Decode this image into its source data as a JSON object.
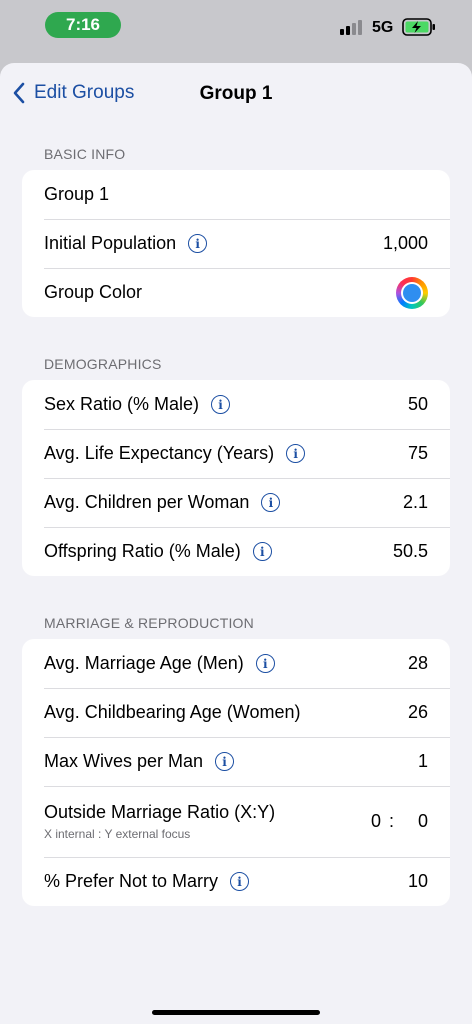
{
  "status": {
    "time": "7:16",
    "network": "5G"
  },
  "nav": {
    "back_label": "Edit Groups",
    "title": "Group 1"
  },
  "basic": {
    "header": "BASIC INFO",
    "name": "Group 1",
    "initial_population_label": "Initial Population",
    "initial_population": "1,000",
    "group_color_label": "Group Color",
    "group_color": "#2f8ef0"
  },
  "demographics": {
    "header": "DEMOGRAPHICS",
    "rows": [
      {
        "label": "Sex Ratio (% Male)",
        "value": "50"
      },
      {
        "label": "Avg. Life Expectancy (Years)",
        "value": "75"
      },
      {
        "label": "Avg. Children per Woman",
        "value": "2.1"
      },
      {
        "label": "Offspring Ratio (% Male)",
        "value": "50.5"
      }
    ]
  },
  "marriage": {
    "header": "MARRIAGE & REPRODUCTION",
    "marriage_age_men_label": "Avg. Marriage Age (Men)",
    "marriage_age_men": "28",
    "childbearing_age_label": "Avg. Childbearing Age (Women)",
    "childbearing_age": "26",
    "max_wives_label": "Max Wives per Man",
    "max_wives": "1",
    "outside_ratio_label": "Outside Marriage Ratio (X:Y)",
    "outside_ratio_sub": "X internal : Y external focus",
    "outside_ratio_x": "0",
    "outside_ratio_y": "0",
    "prefer_not_label": "% Prefer Not to Marry",
    "prefer_not": "10"
  },
  "icons": {
    "back": "chevron-left-icon",
    "info": "info-circle-icon",
    "battery": "battery-charging-icon",
    "signal": "cellular-signal-icon"
  },
  "colors": {
    "accent": "#1c4fa3",
    "time_pill": "#2fa84f",
    "background": "#f2f2f7"
  }
}
